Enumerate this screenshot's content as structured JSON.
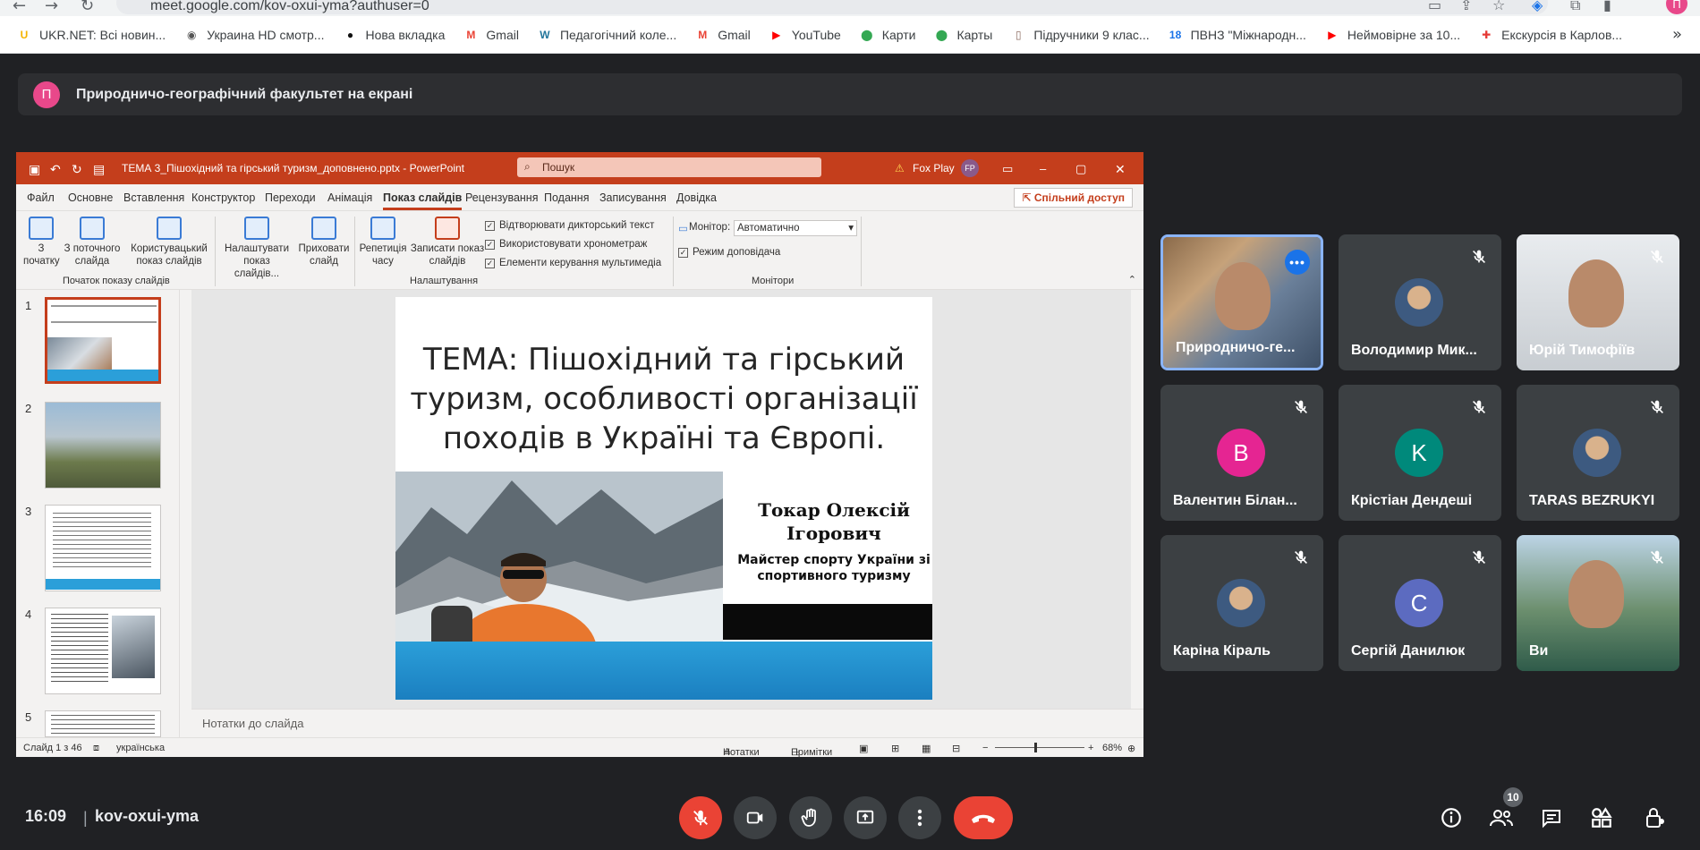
{
  "browser": {
    "url": "meet.google.com/kov-oxui-yma?authuser=0",
    "profile_initial": "П",
    "bookmarks": [
      {
        "label": "UKR.NET: Всі новин...",
        "icon": "ukrnet-icon",
        "color": "#f5b400"
      },
      {
        "label": "Украина HD смотр...",
        "icon": "tv-icon",
        "color": "#555555"
      },
      {
        "label": "Нова вкладка",
        "icon": "github-icon",
        "color": "#111111"
      },
      {
        "label": "Gmail",
        "icon": "gmail-icon",
        "color": "#ea4335"
      },
      {
        "label": "Педагогічний коле...",
        "icon": "wordpress-icon",
        "color": "#21759b"
      },
      {
        "label": "Gmail",
        "icon": "gmail-icon",
        "color": "#ea4335"
      },
      {
        "label": "YouTube",
        "icon": "youtube-icon",
        "color": "#ff0000"
      },
      {
        "label": "Карти",
        "icon": "maps-pin-icon",
        "color": "#34a853"
      },
      {
        "label": "Карты",
        "icon": "maps-pin-icon",
        "color": "#34a853"
      },
      {
        "label": "Підручники 9 клас...",
        "icon": "book-icon",
        "color": "#8d6e63"
      },
      {
        "label": "ПВНЗ \"Міжнародн...",
        "icon": "calendar-icon",
        "color": "#1a73e8"
      },
      {
        "label": "Неймовірне за 10...",
        "icon": "youtube-icon",
        "color": "#ff0000"
      },
      {
        "label": "Екскурсія в Карлов...",
        "icon": "red-cross-icon",
        "color": "#e53935"
      }
    ]
  },
  "banner": {
    "avatar_initial": "П",
    "text": "Природничо-географічний факультет на екрані"
  },
  "powerpoint": {
    "file_title": "ТЕМА 3_Пішохідний та гірський туризм_доповнено.pptx  -  PowerPoint",
    "search_placeholder": "Пошук",
    "account": "Fox Play",
    "account_initials": "FP",
    "tabs": [
      "Файл",
      "Основне",
      "Вставлення",
      "Конструктор",
      "Переходи",
      "Анімація",
      "Показ слайдів",
      "Рецензування",
      "Подання",
      "Записування",
      "Довідка"
    ],
    "active_tab": "Показ слайдів",
    "share_label": "Спільний доступ",
    "ribbon": {
      "from_start": "З початку",
      "from_current": "З поточного слайда",
      "custom_show": "Користувацький показ слайдів",
      "group_start": "Початок показу слайдів",
      "setup_show": "Налаштувати показ слайдів...",
      "hide_slide": "Приховати слайд",
      "rehearse": "Репетиція часу",
      "record": "Записати показ слайдів",
      "check_narration": "Відтворювати дикторський текст",
      "check_timings": "Використовувати хронометраж",
      "check_media": "Елементи керування мультимедіа",
      "group_setup": "Налаштування",
      "monitor_label": "Монітор:",
      "monitor_value": "Автоматично",
      "presenter_view": "Режим доповідача",
      "group_monitors": "Монітори"
    },
    "thumb_numbers": [
      "1",
      "2",
      "3",
      "4",
      "5"
    ],
    "slide": {
      "title_line1": "ТЕМА: Пішохідний та гірський",
      "title_line2": "туризм, особливості організації",
      "title_line3": "походів в Україні та Європі.",
      "author_line1": "Токар Олексій",
      "author_line2": "Ігорович",
      "subtitle_line1": "Майстер спорту України зі",
      "subtitle_line2": "спортивного туризму"
    },
    "notes_placeholder": "Нотатки до слайда",
    "status": {
      "slide_count": "Слайд 1 з 46",
      "language": "українська",
      "notes": "Нотатки",
      "comments": "Примітки",
      "zoom": "68%"
    }
  },
  "participants": [
    {
      "name": "Природничо-ге...",
      "type": "video",
      "active": true
    },
    {
      "name": "Володимир Мик...",
      "type": "photo",
      "muted": true
    },
    {
      "name": "Юрій Тимофіїв",
      "type": "video",
      "muted": true
    },
    {
      "name": "Валентин Білан...",
      "type": "letter",
      "initial": "В",
      "color": "#e52592",
      "muted": true
    },
    {
      "name": "Крістіан Дендеші",
      "type": "letter",
      "initial": "K",
      "color": "#00897b",
      "muted": true
    },
    {
      "name": "TARAS BEZRUKYI",
      "type": "photo",
      "muted": true
    },
    {
      "name": "Каріна Кіраль",
      "type": "photo",
      "muted": true
    },
    {
      "name": "Сергій Данилюк",
      "type": "letter",
      "initial": "C",
      "color": "#5c6bc0",
      "muted": true
    },
    {
      "name": "Ви",
      "type": "video",
      "muted": true
    }
  ],
  "bottom": {
    "time": "16:09",
    "separator": "|",
    "meeting_code": "kov-oxui-yma",
    "participants_count": "10"
  }
}
